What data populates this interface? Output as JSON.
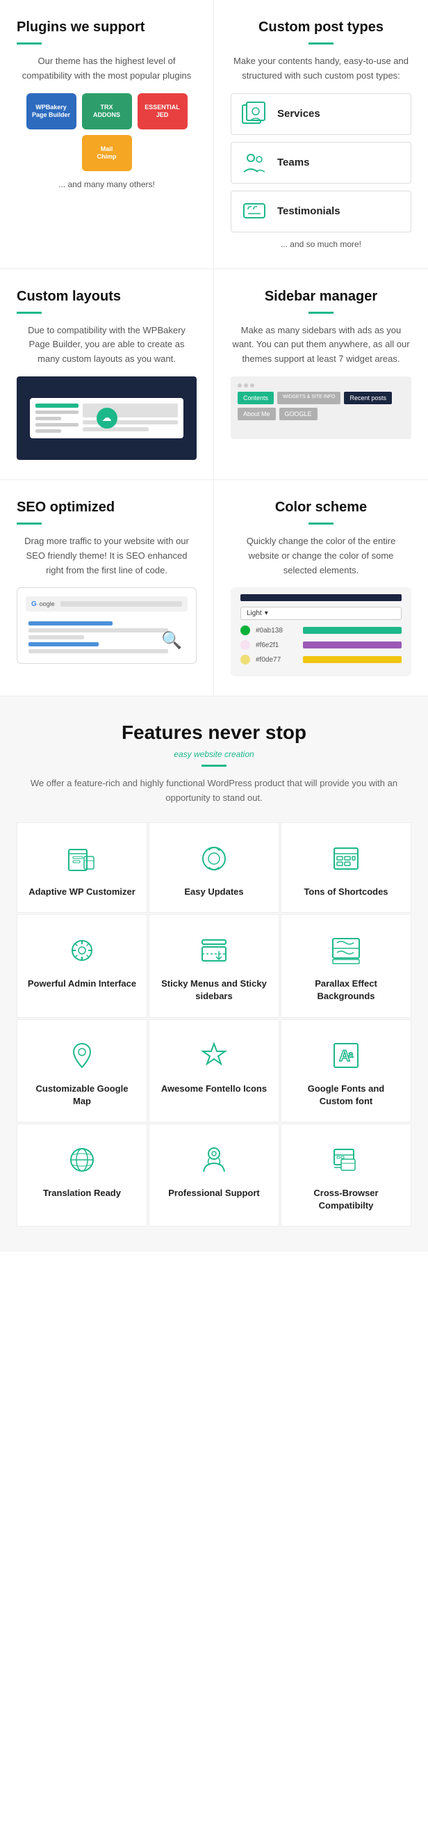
{
  "plugins": {
    "title": "Plugins we support",
    "description": "Our theme has the highest level of compatibility with the most popular plugins",
    "items": [
      {
        "name": "WPBakery\nPage Builder",
        "class": "plugin-wpbakery"
      },
      {
        "name": "TRX\nADDONS",
        "class": "plugin-trx"
      },
      {
        "name": "ESSENTIAL\nJED",
        "class": "plugin-essential"
      },
      {
        "name": "MailChimp",
        "class": "plugin-mailchimp"
      }
    ],
    "note": "... and many many others!"
  },
  "custom_post_types": {
    "title": "Custom post types",
    "description": "Make your contents handy, easy-to-use and structured with such custom post types:",
    "items": [
      {
        "label": "Services"
      },
      {
        "label": "Teams"
      },
      {
        "label": "Testimonials"
      }
    ],
    "note": "... and so much more!"
  },
  "custom_layouts": {
    "title": "Custom layouts",
    "description": "Due to compatibility with the WPBakery Page Builder, you are able to create as many custom layouts as you want."
  },
  "sidebar_manager": {
    "title": "Sidebar manager",
    "description": "Make as many sidebars with ads as you want. You can put them anywhere, as all our themes support at least 7 widget areas.",
    "buttons": [
      "Contents",
      "WIDGETS & SITE INFO",
      "Recent posts",
      "About Me",
      "GOOGLE"
    ]
  },
  "seo": {
    "title": "SEO optimized",
    "description": "Drag more traffic to your website with our SEO friendly theme! It is SEO enhanced right from the first line of code."
  },
  "color_scheme": {
    "title": "Color scheme",
    "description": "Quickly change the color of the entire website or change the color of some selected elements.",
    "dropdown_label": "Light",
    "colors": [
      {
        "hex": "#0ab138",
        "bar_color": "#1db88a"
      },
      {
        "hex": "#f6e2f1",
        "bar_color": "#9b59b6"
      },
      {
        "hex": "#f0de77",
        "bar_color": "#f1c40f"
      }
    ]
  },
  "features": {
    "title": "Features never stop",
    "subtitle": "easy website creation",
    "description": "We offer a feature-rich and highly functional WordPress product\nthat will provide you with an opportunity to stand out.",
    "items": [
      {
        "label": "Adaptive WP\nCustomizer"
      },
      {
        "label": "Easy\nUpdates"
      },
      {
        "label": "Tons of\nShortcodes"
      },
      {
        "label": "Powerful Admin\nInterface"
      },
      {
        "label": "Sticky Menus and\nSticky sidebars"
      },
      {
        "label": "Parallax Effect\nBackgrounds"
      },
      {
        "label": "Customizable\nGoogle Map"
      },
      {
        "label": "Awesome\nFontello Icons"
      },
      {
        "label": "Google Fonts and\nCustom font"
      },
      {
        "label": "Translation\nReady"
      },
      {
        "label": "Professional\nSupport"
      },
      {
        "label": "Cross-Browser\nCompatibilty"
      }
    ]
  }
}
